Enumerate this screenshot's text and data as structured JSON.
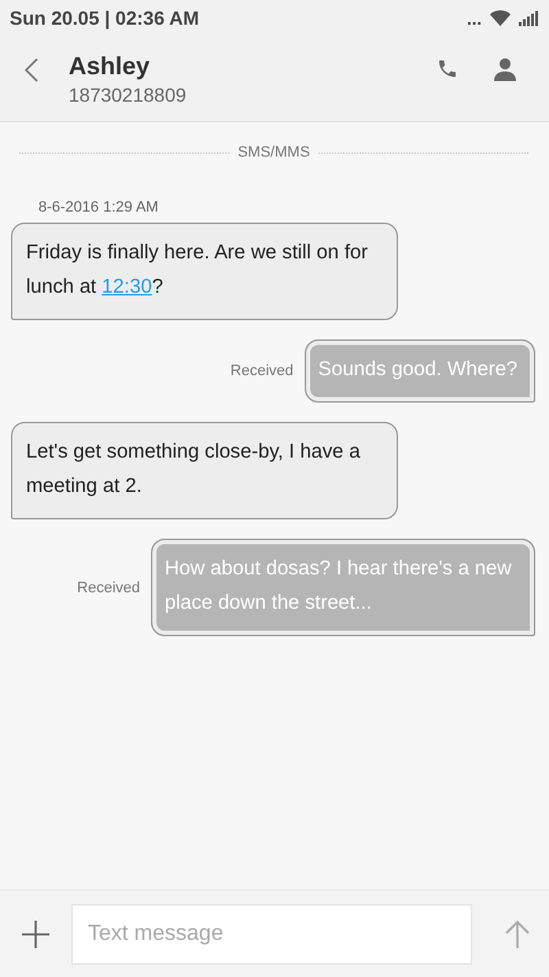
{
  "status_bar": {
    "time": "Sun 20.05 | 02:36 AM",
    "dots": "..."
  },
  "header": {
    "name": "Ashley",
    "number": "18730218809"
  },
  "section_label": "SMS/MMS",
  "timestamp": "8-6-2016 1:29 AM",
  "messages": [
    {
      "kind": "incoming",
      "parts": [
        {
          "text": "Friday is finally here. Are we still on for lunch at "
        },
        {
          "text": "12:30",
          "link": true
        },
        {
          "text": "?"
        }
      ]
    },
    {
      "kind": "outgoing",
      "status": "Received",
      "parts": [
        {
          "text": "Sounds good. Where?"
        }
      ]
    },
    {
      "kind": "incoming",
      "parts": [
        {
          "text": "Let's get something close-by, I have a meeting at 2."
        }
      ]
    },
    {
      "kind": "outgoing",
      "status": "Received",
      "parts": [
        {
          "text": "How about dosas? I hear there's a new place down the street..."
        }
      ]
    }
  ],
  "composer": {
    "placeholder": "Text message"
  }
}
